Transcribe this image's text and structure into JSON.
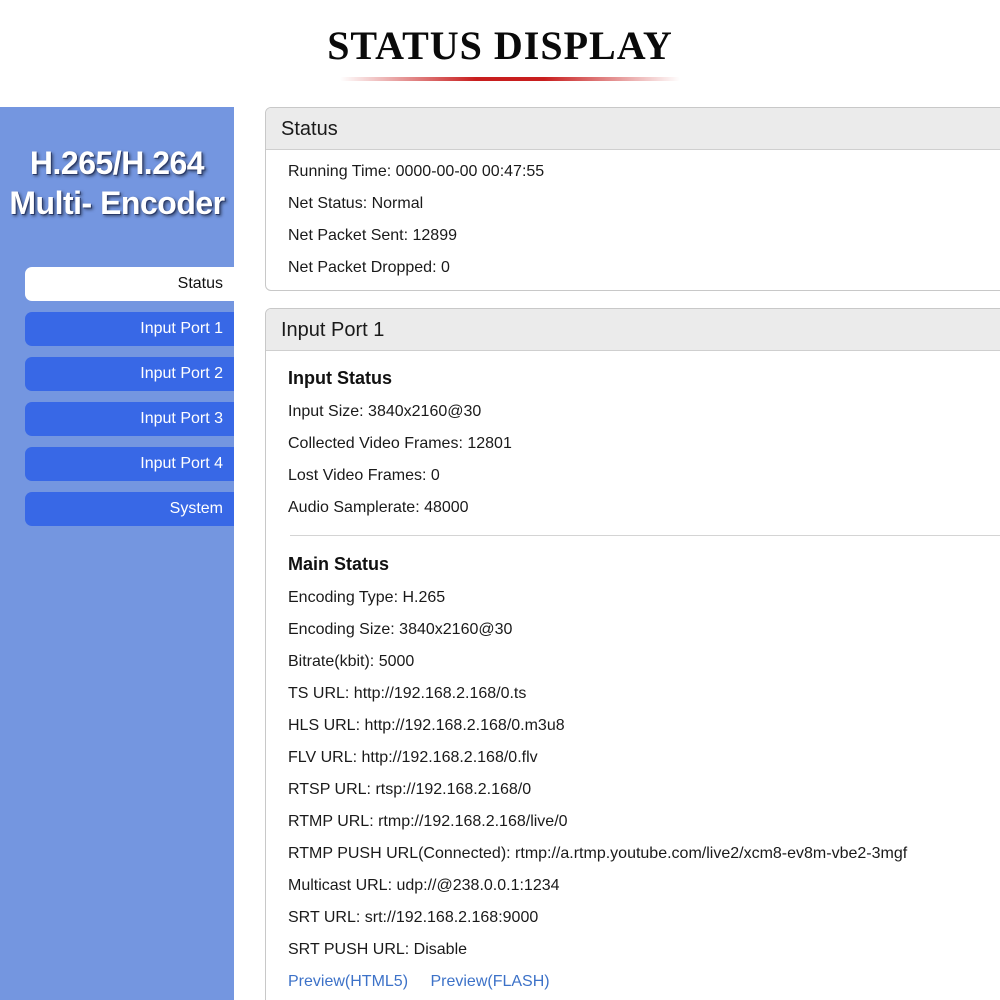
{
  "banner": {
    "title": "STATUS DISPLAY"
  },
  "brand": {
    "line1": "H.265/H.264",
    "line2": "Multi- Encoder"
  },
  "sidebar": {
    "items": [
      {
        "label": "Status"
      },
      {
        "label": "Input Port 1"
      },
      {
        "label": "Input Port 2"
      },
      {
        "label": "Input Port 3"
      },
      {
        "label": "Input Port 4"
      },
      {
        "label": "System"
      }
    ],
    "active": "Status"
  },
  "status_panel": {
    "title": "Status",
    "rows": [
      "Running Time: 0000-00-00 00:47:55",
      "Net Status: Normal",
      "Net Packet Sent: 12899",
      "Net Packet Dropped: 0"
    ]
  },
  "port_panel": {
    "title": "Input Port 1",
    "input_status": {
      "title": "Input Status",
      "rows": [
        "Input Size: 3840x2160@30",
        "Collected Video Frames: 12801",
        "Lost Video Frames: 0",
        "Audio Samplerate: 48000"
      ]
    },
    "main_status": {
      "title": "Main Status",
      "rows": [
        "Encoding Type: H.265",
        "Encoding Size: 3840x2160@30",
        "Bitrate(kbit): 5000",
        "TS URL: http://192.168.2.168/0.ts",
        "HLS URL: http://192.168.2.168/0.m3u8",
        "FLV URL: http://192.168.2.168/0.flv",
        "RTSP URL: rtsp://192.168.2.168/0",
        "RTMP URL: rtmp://192.168.2.168/live/0",
        "RTMP PUSH URL(Connected): rtmp://a.rtmp.youtube.com/live2/xcm8-ev8m-vbe2-3mgf",
        "Multicast URL: udp://@238.0.0.1:1234",
        "SRT URL: srt://192.168.2.168:9000",
        "SRT PUSH URL: Disable"
      ]
    },
    "links": {
      "html5": "Preview(HTML5)",
      "flash": "Preview(FLASH)"
    }
  },
  "colors": {
    "sidebar_bg": "#7496e0",
    "nav_button": "#3868e6",
    "link": "#3d72c8",
    "banner_accent": "#c81e1e"
  }
}
